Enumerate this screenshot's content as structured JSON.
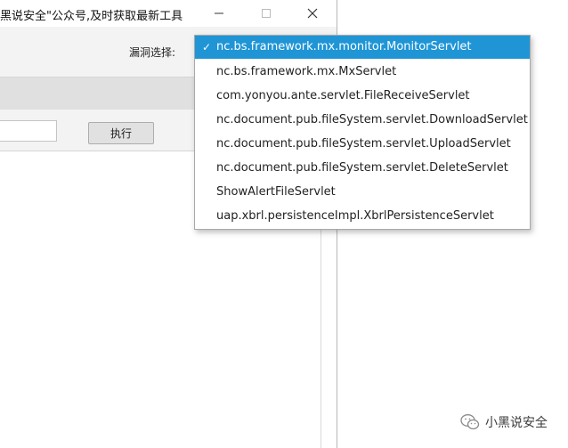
{
  "window": {
    "title": "黑说安全\"公众号,及时获取最新工具"
  },
  "toolbar": {
    "vuln_label": "漏洞选择:"
  },
  "input_row": {
    "url_value": "",
    "execute_label": "执行"
  },
  "dropdown": {
    "check_glyph": "✓",
    "selected_index": 0,
    "options": [
      "nc.bs.framework.mx.monitor.MonitorServlet",
      "nc.bs.framework.mx.MxServlet",
      "com.yonyou.ante.servlet.FileReceiveServlet",
      "nc.document.pub.fileSystem.servlet.DownloadServlet",
      "nc.document.pub.fileSystem.servlet.UploadServlet",
      "nc.document.pub.fileSystem.servlet.DeleteServlet",
      "ShowAlertFileServlet",
      "uap.xbrl.persistenceImpl.XbrlPersistenceServlet"
    ]
  },
  "watermark": {
    "text": "小黑说安全",
    "icon": "wechat-icon"
  },
  "colors": {
    "selection": "#1f95d6",
    "window_bg": "#f3f3f3",
    "band": "#e0e0e0"
  }
}
